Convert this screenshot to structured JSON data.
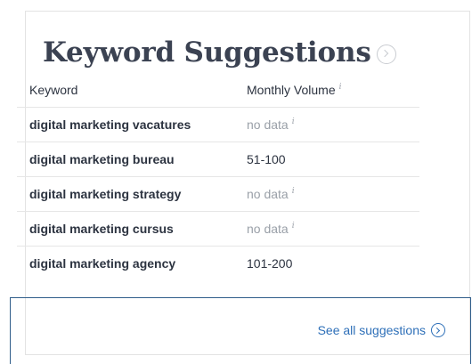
{
  "widget": {
    "title": "Keyword Suggestions",
    "title_icon": "chevron-right-circle-icon"
  },
  "table": {
    "columns": {
      "keyword": "Keyword",
      "volume": "Monthly Volume",
      "volume_info_icon": "i"
    },
    "rows": [
      {
        "keyword": "digital marketing vacatures",
        "volume": "no data",
        "info": "i"
      },
      {
        "keyword": "digital marketing bureau",
        "volume": "51-100",
        "info": ""
      },
      {
        "keyword": "digital marketing strategy",
        "volume": "no data",
        "info": "i"
      },
      {
        "keyword": "digital marketing cursus",
        "volume": "no data",
        "info": "i"
      },
      {
        "keyword": "digital marketing agency",
        "volume": "101-200",
        "info": ""
      }
    ]
  },
  "footer": {
    "see_all_label": "See all suggestions",
    "see_all_icon": "chevron-right-circle-icon"
  },
  "colors": {
    "link": "#2d6fb8",
    "muted": "#9aa0a8",
    "highlight_border": "#2f5d8a"
  }
}
